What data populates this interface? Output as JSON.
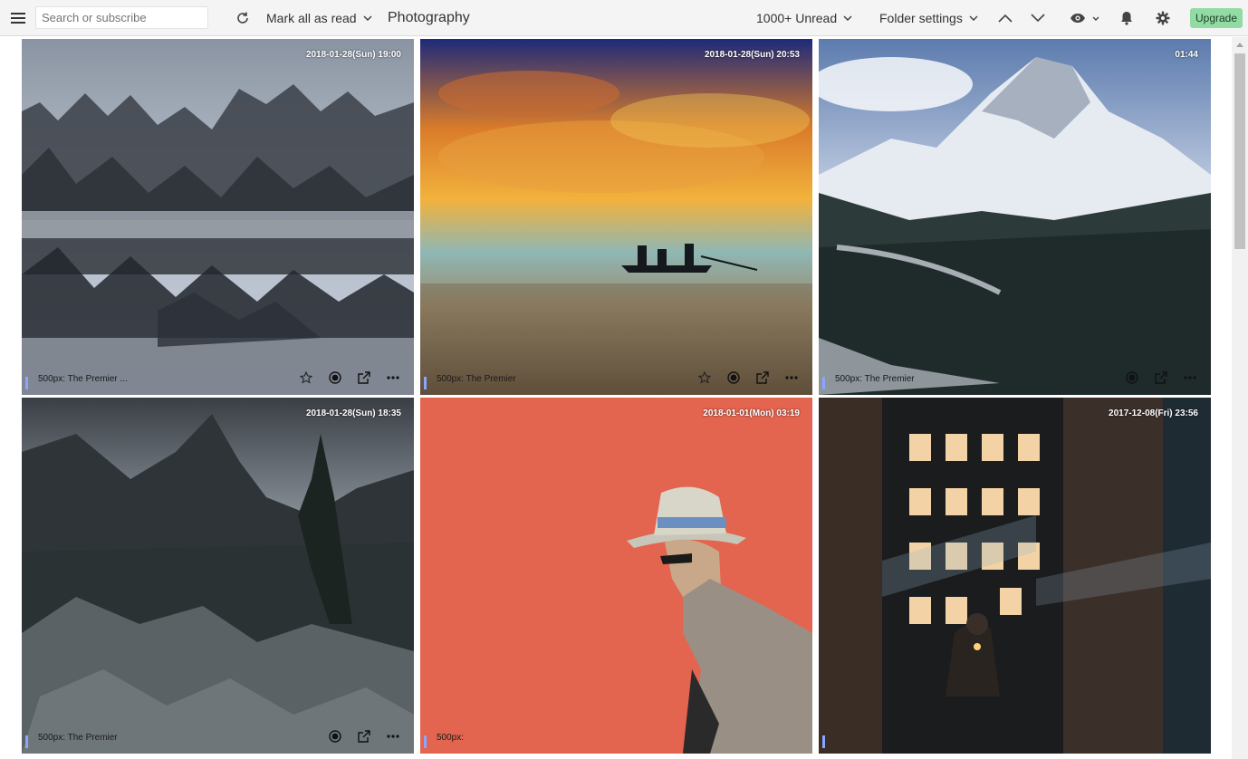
{
  "toolbar": {
    "search_placeholder": "Search or subscribe",
    "mark_all_read": "Mark all as read",
    "feed_title": "Photography",
    "unread": "1000+ Unread",
    "folder_settings": "Folder settings",
    "upgrade": "Upgrade"
  },
  "articles": [
    {
      "date": "2018-01-28(Sun) 19:00",
      "source": "500px: The Premier ..."
    },
    {
      "date": "2018-01-28(Sun) 20:53",
      "source": "500px: The Premier"
    },
    {
      "date": "01:44",
      "source": "500px: The Premier"
    },
    {
      "date": "2018-01-28(Sun) 18:35",
      "source": "500px: The Premier"
    },
    {
      "date": "2018-01-01(Mon) 03:19",
      "source": "500px:"
    },
    {
      "date": "2017-12-08(Fri) 23:56",
      "source": ""
    }
  ],
  "colors": {
    "accent": "#93dba4",
    "source_bar": "#8aa4ff"
  }
}
